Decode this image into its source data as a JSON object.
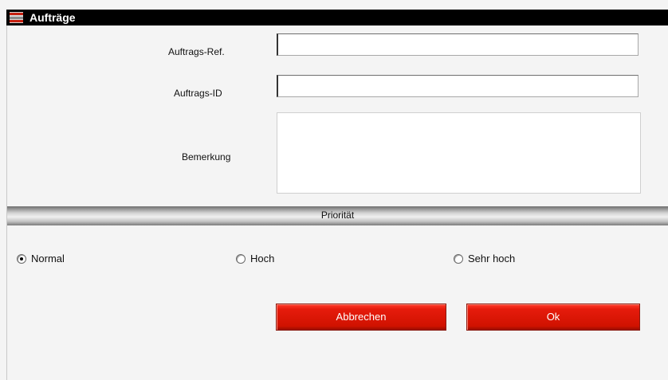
{
  "window": {
    "title": "Aufträge",
    "icon": "app-logo-icon"
  },
  "form": {
    "order_ref": {
      "label": "Auftrags-Ref.",
      "value": "",
      "placeholder": ""
    },
    "order_id": {
      "label": "Auftrags-ID",
      "value": "",
      "placeholder": ""
    },
    "remark": {
      "label": "Bemerkung",
      "value": "",
      "placeholder": ""
    }
  },
  "priority": {
    "title": "Priorität",
    "options": [
      {
        "label": "Normal",
        "checked": true
      },
      {
        "label": "Hoch",
        "checked": false
      },
      {
        "label": "Sehr hoch",
        "checked": false
      }
    ]
  },
  "buttons": {
    "cancel_label": "Abbrechen",
    "ok_label": "Ok"
  },
  "colors": {
    "titlebar": "#000000",
    "button_red": "#e51b0c"
  }
}
